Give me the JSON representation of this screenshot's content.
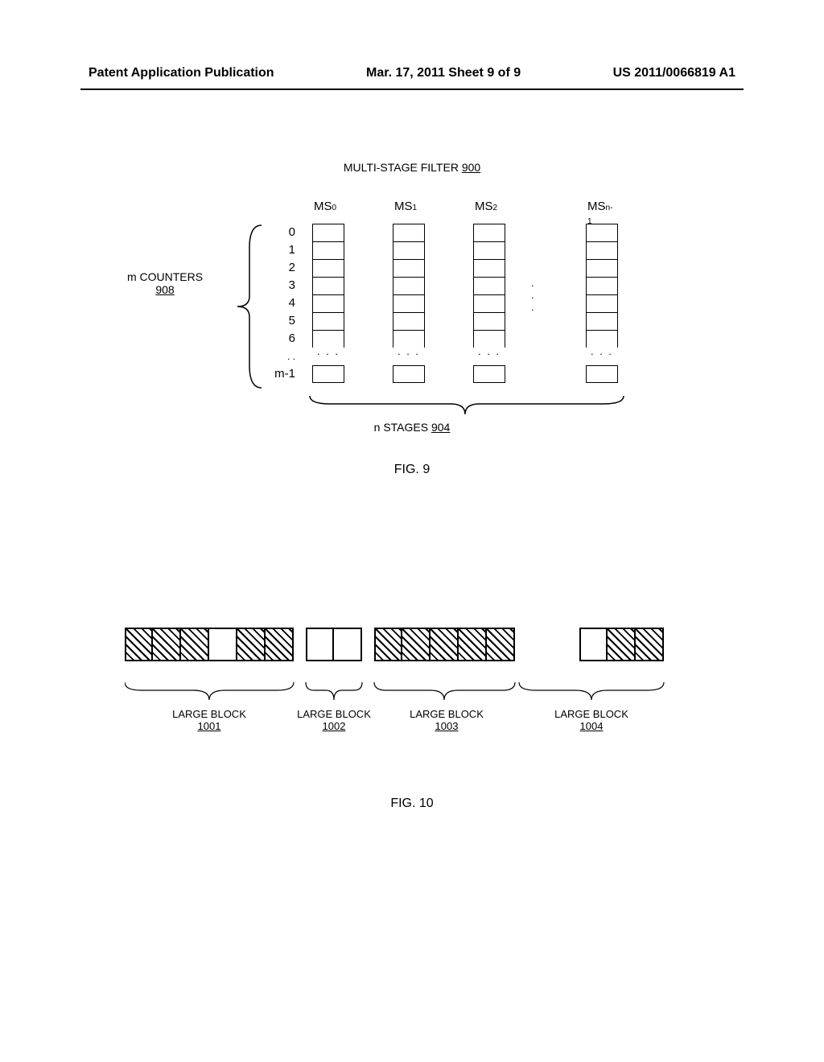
{
  "header": {
    "left": "Patent Application Publication",
    "center": "Mar. 17, 2011  Sheet 9 of 9",
    "right": "US 2011/0066819 A1"
  },
  "fig9": {
    "title_text": "MULTI-STAGE FILTER ",
    "title_ref": "900",
    "stages": [
      "MS",
      "MS",
      "MS",
      "MS"
    ],
    "stage_subs": [
      "0",
      "1",
      "2",
      "n-1"
    ],
    "rows": [
      "0",
      "1",
      "2",
      "3",
      "4",
      "5",
      "6"
    ],
    "row_dots": ". . .",
    "row_last": "m-1",
    "dots_h": ". . .",
    "counters_text": "m COUNTERS",
    "counters_ref": "908",
    "stages_text": "n STAGES ",
    "stages_ref": "904",
    "caption": "FIG. 9"
  },
  "fig10": {
    "labels": [
      "LARGE BLOCK",
      "LARGE BLOCK",
      "LARGE BLOCK",
      "LARGE BLOCK"
    ],
    "refs": [
      "1001",
      "1002",
      "1003",
      "1004"
    ],
    "caption": "FIG. 10"
  },
  "chart_data": [
    {
      "type": "table",
      "title": "MULTI-STAGE FILTER 900",
      "description": "Grid of counters: m rows x n stages",
      "rows_label": "m COUNTERS 908",
      "row_indices": [
        "0",
        "1",
        "2",
        "3",
        "4",
        "5",
        "6",
        "...",
        "m-1"
      ],
      "columns_label": "n STAGES 904",
      "column_headers": [
        "MS0",
        "MS1",
        "MS2",
        "...",
        "MSn-1"
      ]
    },
    {
      "type": "bar",
      "title": "FIG. 10 block layout",
      "description": "Four large blocks each containing sub-blocks; hatched = filled, blank = empty",
      "series": [
        {
          "name": "LARGE BLOCK 1001",
          "pattern": [
            "hatched",
            "hatched",
            "hatched",
            "blank",
            "hatched",
            "hatched"
          ]
        },
        {
          "name": "LARGE BLOCK 1002",
          "pattern": [
            "blank",
            "blank"
          ]
        },
        {
          "name": "LARGE BLOCK 1003",
          "pattern": [
            "hatched",
            "hatched",
            "hatched",
            "hatched",
            "hatched"
          ]
        },
        {
          "name": "LARGE BLOCK 1004",
          "pattern": [
            "blank",
            "hatched",
            "hatched"
          ]
        }
      ]
    }
  ]
}
